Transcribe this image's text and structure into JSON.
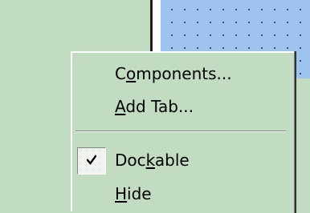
{
  "context_menu": {
    "items": [
      {
        "label_before": "C",
        "mnemonic": "o",
        "label_after": "mponents...",
        "checked": false
      },
      {
        "label_before": "",
        "mnemonic": "A",
        "label_after": "dd Tab...",
        "checked": false
      },
      {
        "label_before": "Doc",
        "mnemonic": "k",
        "label_after": "able",
        "checked": true
      },
      {
        "label_before": "",
        "mnemonic": "H",
        "label_after": "ide",
        "checked": false
      }
    ]
  },
  "icons": {
    "check": "check-icon"
  },
  "colors": {
    "menu_background": "#c2dcc2",
    "design_surface": "#9fc3ef",
    "grid_dot": "#3a4e6a"
  }
}
